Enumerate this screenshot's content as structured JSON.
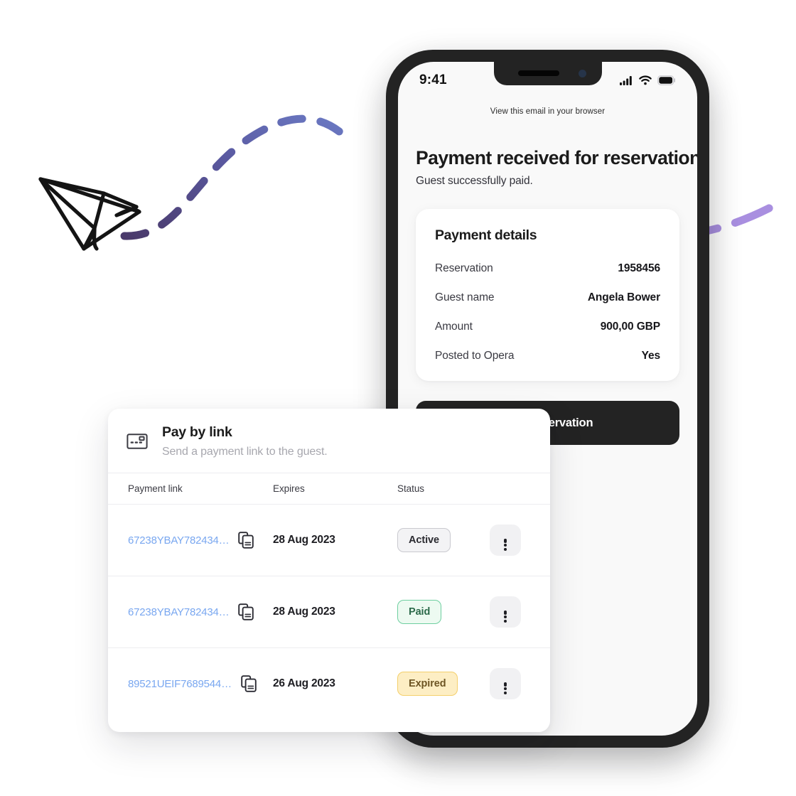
{
  "phone": {
    "status_bar": {
      "time": "9:41",
      "icons": [
        "cellular-signal-icon",
        "wifi-icon",
        "battery-icon"
      ]
    },
    "email": {
      "browser_note": "View this email in your browser",
      "title": "Payment received for reservation",
      "subtitle": "Guest successfully paid.",
      "cta_label": "View reservation"
    },
    "payment_details": {
      "heading": "Payment details",
      "rows": [
        {
          "label": "Reservation",
          "value": "1958456"
        },
        {
          "label": "Guest name",
          "value": "Angela Bower"
        },
        {
          "label": "Amount",
          "value": "900,00 GBP"
        },
        {
          "label": "Posted to Opera",
          "value": "Yes"
        }
      ]
    }
  },
  "pay_by_link": {
    "icon": "payment-card-icon",
    "title": "Pay by link",
    "description": "Send a payment link to the guest.",
    "columns": [
      "Payment link",
      "Expires",
      "Status"
    ],
    "rows": [
      {
        "link": "67238YBAY782434…",
        "expires": "28 Aug 2023",
        "status": "Active",
        "status_kind": "active",
        "copy_icon": "copy-icon",
        "menu_icon": "kebab-menu-icon"
      },
      {
        "link": "67238YBAY782434…",
        "expires": "28 Aug 2023",
        "status": "Paid",
        "status_kind": "paid",
        "copy_icon": "copy-icon",
        "menu_icon": "kebab-menu-icon"
      },
      {
        "link": "89521UEIF7689544…",
        "expires": "26 Aug 2023",
        "status": "Expired",
        "status_kind": "expired",
        "copy_icon": "copy-icon",
        "menu_icon": "kebab-menu-icon"
      }
    ]
  },
  "decorations": {
    "paper_plane": "paper-plane-illustration",
    "left_trail": "dashed-flight-path",
    "right_arrow": "dashed-arrow-curve",
    "colors": {
      "trail_dark": "#4a3a6b",
      "trail_light": "#6b7ac4",
      "arrow_purple": "#a98fe0",
      "link_blue": "#79a7f0",
      "paid_green": "#6ecfa0",
      "expired_amber": "#f4cf6b",
      "phone_frame": "#232323"
    }
  }
}
